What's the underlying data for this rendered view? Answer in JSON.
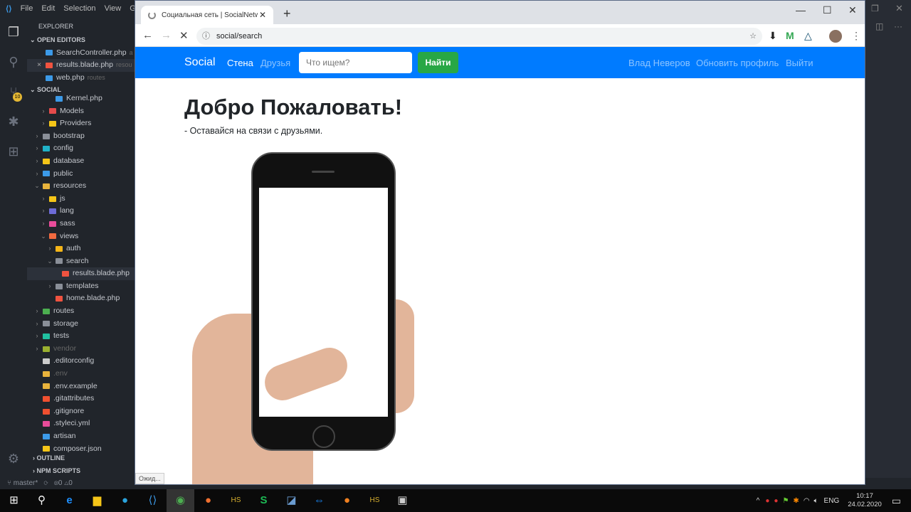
{
  "vscode": {
    "menu": [
      "File",
      "Edit",
      "Selection",
      "View",
      "G"
    ],
    "scm_badge": "10",
    "explorer_title": "EXPLORER",
    "open_editors_title": "OPEN EDITORS",
    "open_editors": [
      {
        "name": "SearchController.php",
        "hint": "a",
        "color": "#3c9ae8"
      },
      {
        "name": "results.blade.php",
        "hint": "resou",
        "color": "#f05340",
        "close": "×"
      },
      {
        "name": "web.php",
        "hint": "routes",
        "color": "#3c9ae8"
      }
    ],
    "project_title": "SOCIAL",
    "tree": [
      {
        "name": "Kernel.php",
        "indent": 3,
        "color": "#3c9ae8",
        "chev": ""
      },
      {
        "name": "Models",
        "indent": 2,
        "color": "#e54b4b",
        "chev": "›"
      },
      {
        "name": "Providers",
        "indent": 2,
        "color": "#f5c518",
        "chev": "›"
      },
      {
        "name": "bootstrap",
        "indent": 1,
        "color": "#8a8f98",
        "chev": "›"
      },
      {
        "name": "config",
        "indent": 1,
        "color": "#20b2c8",
        "chev": "›"
      },
      {
        "name": "database",
        "indent": 1,
        "color": "#f5c518",
        "chev": "›"
      },
      {
        "name": "public",
        "indent": 1,
        "color": "#3c9ae8",
        "chev": "›"
      },
      {
        "name": "resources",
        "indent": 1,
        "color": "#e8b33c",
        "chev": "⌄"
      },
      {
        "name": "js",
        "indent": 2,
        "color": "#f5c518",
        "chev": "›"
      },
      {
        "name": "lang",
        "indent": 2,
        "color": "#6d6bd6",
        "chev": "›"
      },
      {
        "name": "sass",
        "indent": 2,
        "color": "#e84c9a",
        "chev": "›"
      },
      {
        "name": "views",
        "indent": 2,
        "color": "#f06a40",
        "chev": "⌄"
      },
      {
        "name": "auth",
        "indent": 3,
        "color": "#f5b518",
        "chev": "›"
      },
      {
        "name": "search",
        "indent": 3,
        "color": "#8a8f98",
        "chev": "⌄"
      },
      {
        "name": "results.blade.php",
        "indent": 4,
        "color": "#f05340",
        "chev": "",
        "selected": true
      },
      {
        "name": "templates",
        "indent": 3,
        "color": "#8a8f98",
        "chev": "›"
      },
      {
        "name": "home.blade.php",
        "indent": 3,
        "color": "#f05340",
        "chev": ""
      },
      {
        "name": "routes",
        "indent": 1,
        "color": "#4caf50",
        "chev": "›"
      },
      {
        "name": "storage",
        "indent": 1,
        "color": "#8a8f98",
        "chev": "›"
      },
      {
        "name": "tests",
        "indent": 1,
        "color": "#20c0a0",
        "chev": "›"
      },
      {
        "name": "vendor",
        "indent": 1,
        "color": "#9ab030",
        "chev": "›",
        "dim": true
      },
      {
        "name": ".editorconfig",
        "indent": 1,
        "color": "#ccc",
        "chev": ""
      },
      {
        "name": ".env",
        "indent": 1,
        "color": "#e8b33c",
        "chev": "",
        "dim": true
      },
      {
        "name": ".env.example",
        "indent": 1,
        "color": "#e8b33c",
        "chev": ""
      },
      {
        "name": ".gitattributes",
        "indent": 1,
        "color": "#f05030",
        "chev": ""
      },
      {
        "name": ".gitignore",
        "indent": 1,
        "color": "#f05030",
        "chev": ""
      },
      {
        "name": ".styleci.yml",
        "indent": 1,
        "color": "#e84c9a",
        "chev": ""
      },
      {
        "name": "artisan",
        "indent": 1,
        "color": "#3c9ae8",
        "chev": ""
      },
      {
        "name": "composer.json",
        "indent": 1,
        "color": "#f5c518",
        "chev": ""
      }
    ],
    "outline": "OUTLINE",
    "npm_scripts": "NPM SCRIPTS",
    "status": {
      "branch": "master*",
      "errors": "0",
      "warnings": "0"
    }
  },
  "browser": {
    "tab_title": "Социальная сеть | SocialNetwork",
    "url": "social/search",
    "status_text": "Ожид..."
  },
  "site": {
    "brand": "Social",
    "nav": [
      "Стена",
      "Друзья"
    ],
    "search_placeholder": "Что ищем?",
    "search_button": "Найти",
    "right_nav": [
      "Влад Неверов",
      "Обновить профиль",
      "Выйти"
    ],
    "heading": "Добро Пожаловать!",
    "subheading": "- Оставайся на связи с друзьями.",
    "colors": {
      "navbar": "#007bff",
      "button": "#28a745"
    }
  },
  "taskbar": {
    "apps": [
      "windows-start",
      "search",
      "edge",
      "file-explorer",
      "telegram",
      "vscode",
      "chrome",
      "firefox",
      "heidisql",
      "skype",
      "mysql-workbench",
      "teamviewer",
      "fl-studio",
      "heidisql-2",
      "remote-desktop"
    ],
    "language": "ENG",
    "time": "10:17",
    "date": "24.02.2020"
  }
}
